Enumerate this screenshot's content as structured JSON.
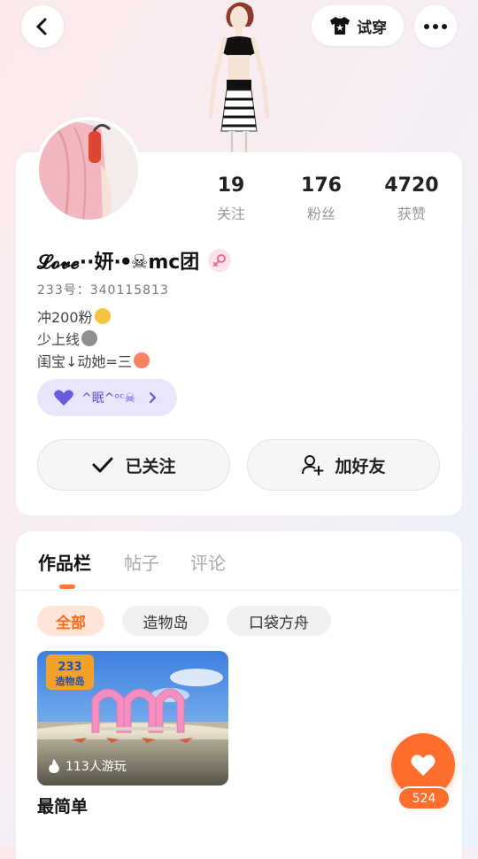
{
  "header": {
    "tryon_label": "试穿"
  },
  "stats": [
    {
      "value": "19",
      "label": "关注"
    },
    {
      "value": "176",
      "label": "粉丝"
    },
    {
      "value": "4720",
      "label": "获赞"
    }
  ],
  "profile": {
    "username": "𝓛𝓸𝓿𝓮··妍·ꔷ☠mc团",
    "uid": "233号：340115813",
    "bio": [
      "冲200粉",
      "少上线",
      "闺宝↓动她=三"
    ],
    "badge_text": "^眠^ᵒᶜ☠"
  },
  "actions": {
    "followed_label": "已关注",
    "add_friend_label": "加好友"
  },
  "tabs": [
    "作品栏",
    "帖子",
    "评论"
  ],
  "filters": [
    "全部",
    "造物岛",
    "口袋方舟"
  ],
  "work": {
    "game_logo": "233造物岛",
    "plays": "113人游玩",
    "title": "最简单"
  },
  "likes": "524",
  "colors": {
    "accent": "#ff6e2c",
    "badge_purple": "#5a54c9"
  }
}
